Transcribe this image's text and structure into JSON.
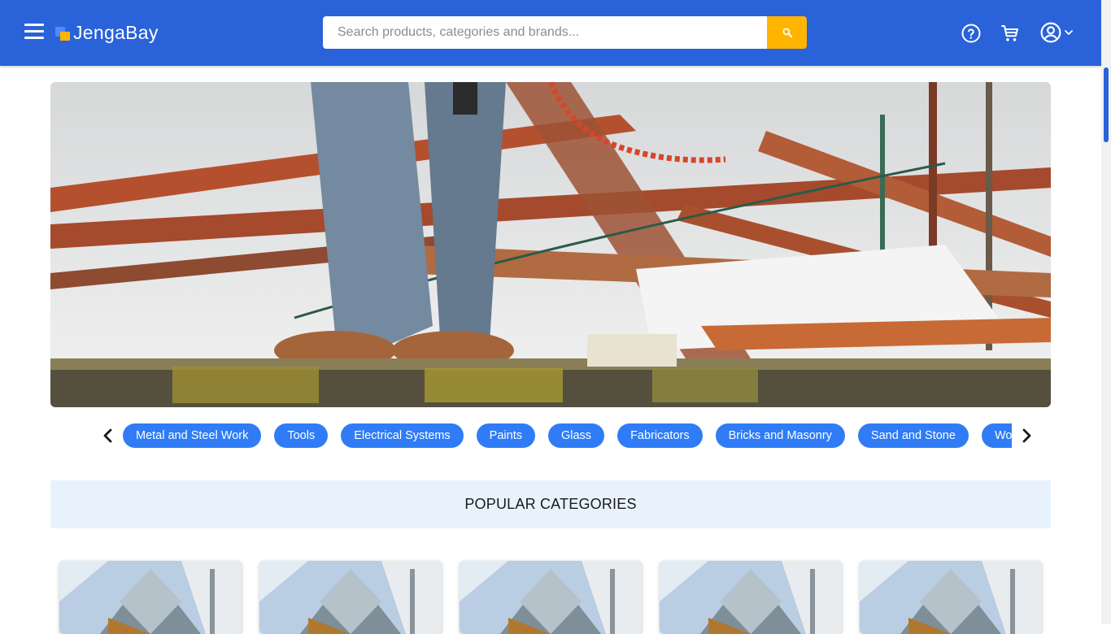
{
  "header": {
    "menu_icon": "hamburger-menu-icon",
    "logo_text": "JengaBay",
    "search_placeholder": "Search products, categories and brands...",
    "icons": [
      "help-circle-icon",
      "cart-icon",
      "account-icon",
      "chevron-down-icon"
    ]
  },
  "colors": {
    "header_bg": "#2962d9",
    "search_button": "#ffb400",
    "chip_bg": "#2f7cf6",
    "popular_bg": "#e8f2fd"
  },
  "categories": [
    "Metal and Steel Work",
    "Tools",
    "Electrical Systems",
    "Paints",
    "Glass",
    "Fabricators",
    "Bricks and Masonry",
    "Sand and Stone",
    "Wood a"
  ],
  "popular": {
    "heading": "POPULAR CATEGORIES"
  }
}
